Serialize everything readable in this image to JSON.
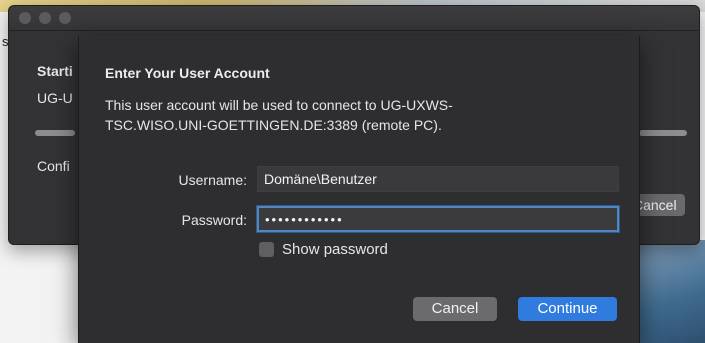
{
  "background_window": {
    "title_fragment": "Starti",
    "host_fragment": "UG-U",
    "status_fragment": "Confi",
    "cancel_fragment": "Cancel"
  },
  "stray_text": "s",
  "dialog": {
    "title": "Enter Your User Account",
    "description": "This user account will be used to connect to UG-UXWS-TSC.WISO.UNI-GOETTINGEN.DE:3389 (remote PC).",
    "username_label": "Username:",
    "username_value": "Domäne\\Benutzer",
    "password_label": "Password:",
    "password_masked": "••••••••••••",
    "show_password_label": "Show password",
    "show_password_checked": false,
    "cancel_label": "Cancel",
    "continue_label": "Continue"
  },
  "colors": {
    "accent": "#2f7bde",
    "focus_ring": "#4f86c3",
    "sheet_bg": "#2e2e30"
  }
}
